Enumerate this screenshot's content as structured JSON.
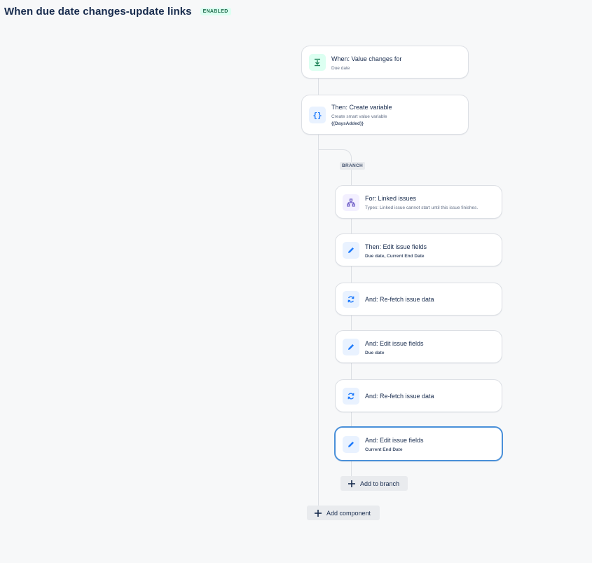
{
  "header": {
    "title": "When due date changes-update links",
    "status": "ENABLED"
  },
  "components": {
    "trigger": {
      "title": "When: Value changes for",
      "subtitle": "Due date",
      "icon": "field-value-changed-icon"
    },
    "create_variable": {
      "title": "Then: Create variable",
      "subtitle": "Create smart value variable",
      "detail": "{{DaysAdded}}",
      "icon": "curly-braces-icon"
    }
  },
  "branch": {
    "label": "BRANCH",
    "for_item": {
      "title": "For: Linked issues",
      "subtitle": "Types: Linked issue cannot start until this issue finishes.",
      "icon": "hierarchy-icon"
    },
    "actions": [
      {
        "title": "Then: Edit issue fields",
        "subtitle": "Due date, Current End Date",
        "icon": "pencil-icon"
      },
      {
        "title": "And: Re-fetch issue data",
        "subtitle": "",
        "icon": "refresh-icon"
      },
      {
        "title": "And: Edit issue fields",
        "subtitle": "Due date",
        "icon": "pencil-icon"
      },
      {
        "title": "And: Re-fetch issue data",
        "subtitle": "",
        "icon": "refresh-icon"
      },
      {
        "title": "And: Edit issue fields",
        "subtitle": "Current End Date",
        "icon": "pencil-icon"
      }
    ],
    "add_to_branch_label": "Add to branch"
  },
  "add_component_label": "Add component",
  "colors": {
    "background": "#f7f8f9",
    "accent_blue": "#1d7afc",
    "trigger_green": "#1f845a",
    "branch_purple": "#6e5dc6",
    "selected_border": "#4a90d9"
  }
}
